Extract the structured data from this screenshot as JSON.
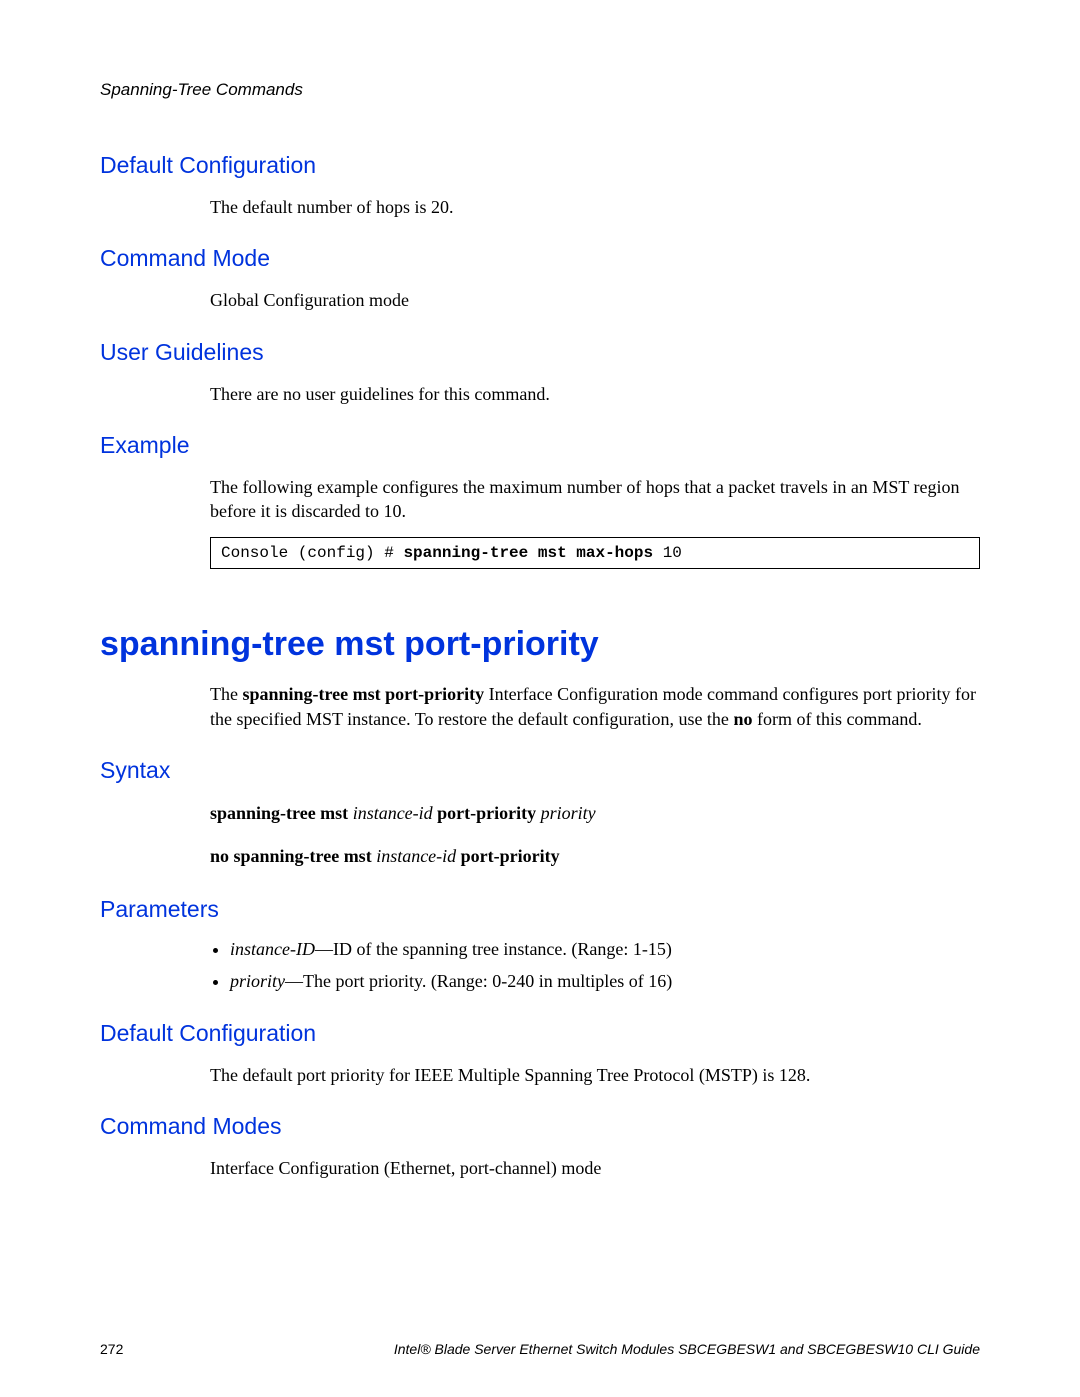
{
  "header": "Spanning-Tree Commands",
  "s1": {
    "h_default_config": "Default Configuration",
    "default_config_text": "The default number of hops is 20.",
    "h_command_mode": "Command Mode",
    "command_mode_text": "Global Configuration mode",
    "h_user_guidelines": "User Guidelines",
    "user_guidelines_text": "There are no user guidelines for this command.",
    "h_example": "Example",
    "example_text": "The following example configures the maximum number of hops that a packet travels in an MST region before it is discarded to 10.",
    "code_prompt": "Console (config) # ",
    "code_bold": "spanning-tree mst max-hops ",
    "code_arg": "10"
  },
  "cmd_title": "spanning-tree mst port-priority",
  "s2": {
    "intro_pre": "The ",
    "intro_bold": "spanning-tree mst port-priority",
    "intro_mid": " Interface Configuration mode command configures port priority for the specified MST instance. To restore the default configuration, use the ",
    "intro_bold2": "no",
    "intro_post": " form of this command.",
    "h_syntax": "Syntax",
    "syntax1_a": "spanning-tree mst ",
    "syntax1_b": "instance-id ",
    "syntax1_c": "port-priority ",
    "syntax1_d": "priority",
    "syntax2_a": "no spanning-tree mst ",
    "syntax2_b": "instance-id ",
    "syntax2_c": "port-priority",
    "h_parameters": "Parameters",
    "param1_term": "instance-ID",
    "param1_desc": "—ID of the spanning tree instance. (Range: 1-15)",
    "param2_term": "priority",
    "param2_desc": "—The port priority. (Range: 0-240 in multiples of 16)",
    "h_default_config": "Default Configuration",
    "default_config_text": "The default port priority for IEEE Multiple Spanning Tree Protocol (MSTP) is 128.",
    "h_command_modes": "Command Modes",
    "command_modes_text": "Interface Configuration (Ethernet, port-channel) mode"
  },
  "footer": {
    "page": "272",
    "title": "Intel® Blade Server Ethernet Switch Modules SBCEGBESW1 and SBCEGBESW10 CLI Guide"
  }
}
